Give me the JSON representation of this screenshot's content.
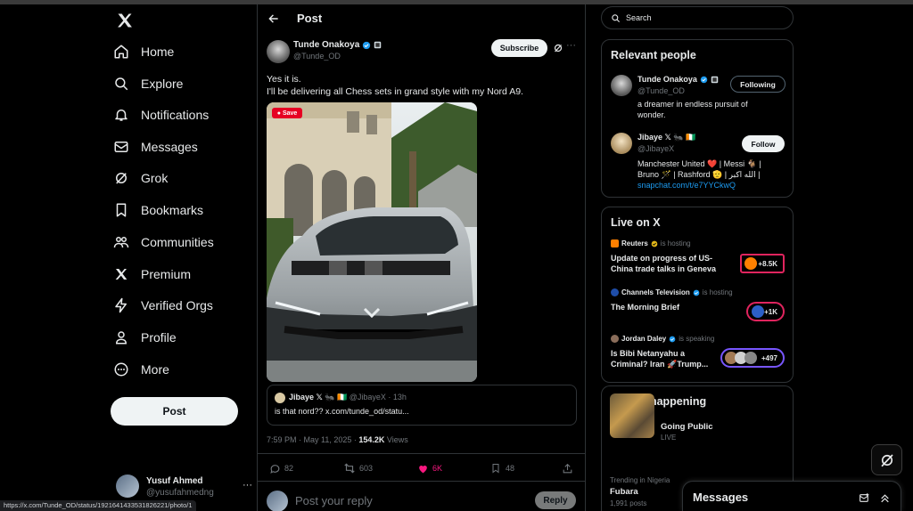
{
  "nav": {
    "items": [
      {
        "label": "Home",
        "icon": "home-icon"
      },
      {
        "label": "Explore",
        "icon": "search-icon"
      },
      {
        "label": "Notifications",
        "icon": "bell-icon"
      },
      {
        "label": "Messages",
        "icon": "envelope-icon"
      },
      {
        "label": "Grok",
        "icon": "grok-icon"
      },
      {
        "label": "Bookmarks",
        "icon": "bookmark-icon"
      },
      {
        "label": "Communities",
        "icon": "people-icon"
      },
      {
        "label": "Premium",
        "icon": "x-logo-icon"
      },
      {
        "label": "Verified Orgs",
        "icon": "lightning-icon"
      },
      {
        "label": "Profile",
        "icon": "person-icon"
      },
      {
        "label": "More",
        "icon": "more-circle-icon"
      }
    ],
    "post_label": "Post",
    "account": {
      "name": "Yusuf Ahmed",
      "handle": "@yusufahmedng",
      "more": "···"
    }
  },
  "post": {
    "header_title": "Post",
    "author": {
      "name": "Tunde Onakoya",
      "handle": "@Tunde_OD"
    },
    "subscribe_label": "Subscribe",
    "more": "···",
    "text_line1": "Yes it is.",
    "text_line2": "I'll be delivering all Chess sets in grand style with my Nord A9.",
    "save_label": "Save",
    "quote": {
      "name": "Jibaye 𝕏 🐜 🇨🇮",
      "handle": "@JibayeX · 13h",
      "text": "is that nord?? x.com/tunde_od/statu..."
    },
    "meta": {
      "time": "7:59 PM · May 11, 2025 · ",
      "views": "154.2K",
      "views_label": " Views"
    },
    "actions": {
      "replies": "82",
      "reposts": "603",
      "likes": "6K",
      "bookmarks": "48"
    },
    "reply_placeholder": "Post your reply",
    "reply_label": "Reply"
  },
  "right": {
    "search_placeholder": "Search",
    "relevant": {
      "title": "Relevant people",
      "people": [
        {
          "name": "Tunde Onakoya",
          "handle": "@Tunde_OD",
          "button": "Following",
          "bio": "a dreamer in endless pursuit of wonder."
        },
        {
          "name": "Jibaye 𝕏 🐜 🇨🇮",
          "handle": "@JibayeX",
          "button": "Follow",
          "bio_line1": "Manchester United ❤️ | Messi 🐐 |",
          "bio_line2": "Bruno 🪄 | Rashford 🫡 | الله اكبر |",
          "bio_link": "snapchat.com/t/e7YYCkwQ"
        }
      ]
    },
    "live": {
      "title": "Live on X",
      "spaces": [
        {
          "host": "Reuters",
          "status": "is hosting",
          "title_line1": "Update on progress of US-",
          "title_line2": "China trade talks in Geneva",
          "count": "+8.5K",
          "color": "#e0245e"
        },
        {
          "host": "Channels Television",
          "status": "is hosting",
          "title_line1": "The Morning Brief",
          "title_line2": "",
          "count": "+1K",
          "color": "#e0245e"
        },
        {
          "host": "Jordan Daley",
          "status": "is speaking",
          "title_line1": "Is Bibi Netanyahu a",
          "title_line2": "Criminal? Iran 🚀Trump...",
          "count": "+497",
          "color": "#7856ff"
        }
      ]
    },
    "happening": {
      "title": "What's happening",
      "event_title": "Going Public",
      "event_sub": "LIVE",
      "trend_context": "Trending in Nigeria",
      "trend_title": "Fubara",
      "trend_posts": "1,991 posts"
    }
  },
  "messages_dock": {
    "title": "Messages"
  },
  "status_url": "https://x.com/Tunde_OD/status/1921641433531826221/photo/1"
}
